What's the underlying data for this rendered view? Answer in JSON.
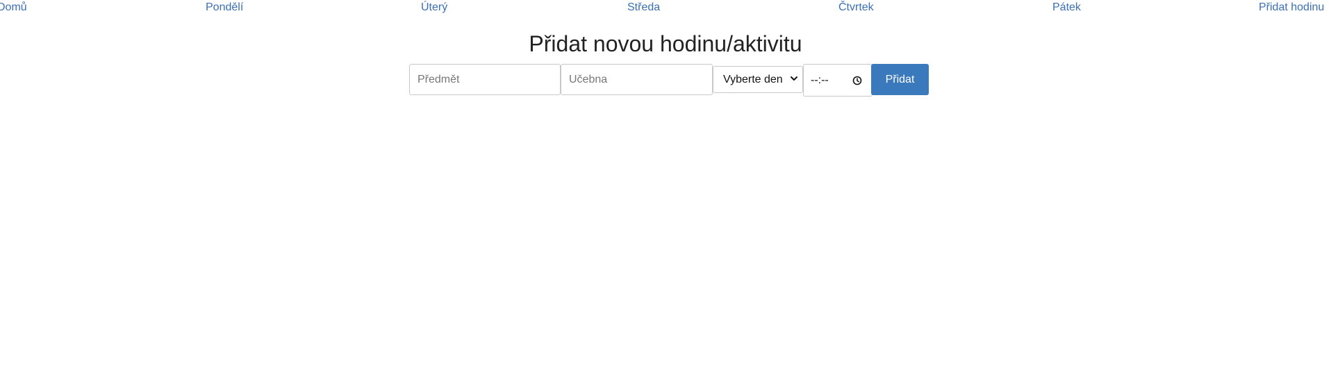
{
  "nav": {
    "items": [
      {
        "label": "Domů"
      },
      {
        "label": "Pondělí"
      },
      {
        "label": "Úterý"
      },
      {
        "label": "Středa"
      },
      {
        "label": "Čtvrtek"
      },
      {
        "label": "Pátek"
      },
      {
        "label": "Přidat hodinu"
      }
    ],
    "link_color": "#3a6fb3"
  },
  "page": {
    "title": "Přidat novou hodinu/aktivitu"
  },
  "form": {
    "subject": {
      "placeholder": "Předmět",
      "value": ""
    },
    "classroom": {
      "placeholder": "Učebna",
      "value": ""
    },
    "day_select": {
      "selected": "Vyberte den"
    },
    "time": {
      "value": "--:--"
    },
    "submit_label": "Přidat",
    "button_color": "#3a79bb"
  },
  "icons": {
    "select": "chevron-down-icon",
    "time": "clock-icon"
  }
}
